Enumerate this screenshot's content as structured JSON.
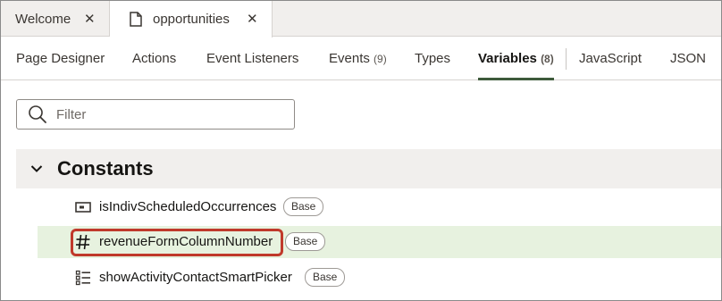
{
  "doc_tabs": [
    {
      "label": "Welcome",
      "close": "✕"
    },
    {
      "label": "opportunities",
      "close": "✕"
    }
  ],
  "sub_tabs": {
    "page_designer": "Page Designer",
    "actions": "Actions",
    "event_listeners": "Event Listeners",
    "events": "Events",
    "events_count": "(9)",
    "types": "Types",
    "variables": "Variables",
    "variables_count": "(8)",
    "javascript": "JavaScript",
    "json": "JSON"
  },
  "filter": {
    "placeholder": "Filter",
    "value": ""
  },
  "constants": {
    "title": "Constants",
    "items": [
      {
        "name": "isIndivScheduledOccurrences",
        "badge": "Base",
        "icon": "boolean-icon"
      },
      {
        "name": "revenueFormColumnNumber",
        "badge": "Base",
        "icon": "number-hash-icon"
      },
      {
        "name": "showActivityContactSmartPicker",
        "badge": "Base",
        "icon": "list-icon"
      }
    ]
  },
  "colors": {
    "active_tab_underline": "#3e5a3b",
    "selected_row": "#e7f2df",
    "highlight_border": "#c0392b",
    "section_header_bg": "#f1efed"
  }
}
